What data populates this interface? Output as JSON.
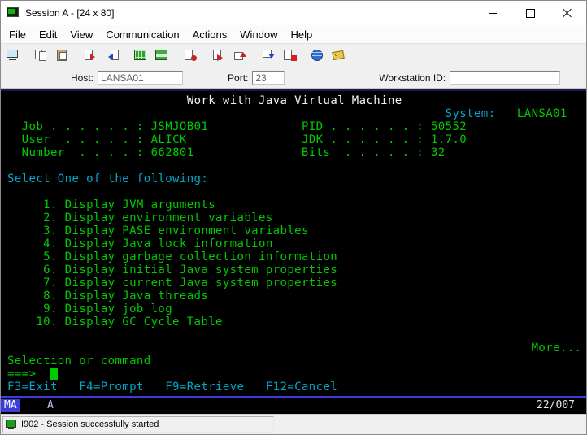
{
  "window": {
    "title": "Session A - [24 x 80]",
    "controls": [
      "minimize-icon",
      "maximize-icon",
      "close-icon"
    ]
  },
  "menu": {
    "items": [
      "File",
      "Edit",
      "View",
      "Communication",
      "Actions",
      "Window",
      "Help"
    ]
  },
  "toolbar": {
    "icons": [
      "new-session-icon",
      "copy-icon",
      "paste-icon",
      "send-file-icon",
      "receive-file-icon",
      "display-map-icon",
      "color-setup-icon",
      "record-macro-icon",
      "play-macro-icon",
      "send-screen-icon",
      "receive-screen-icon",
      "stop-macro-icon",
      "communication-setup-icon",
      "keyboard-map-icon"
    ]
  },
  "hostbar": {
    "host_label": "Host:",
    "host_value": "LANSA01",
    "port_label": "Port:",
    "port_value": "23",
    "workstation_label": "Workstation ID:",
    "workstation_value": ""
  },
  "terminal": {
    "palette": {
      "g": "#00ca00",
      "c": "#00a8cc",
      "w": "#f0f0f0"
    },
    "rows": [
      {
        "segs": [
          [
            26,
            "Work with Java Virtual Machine",
            "w"
          ]
        ]
      },
      {
        "segs": [
          [
            62,
            "System:",
            "c"
          ],
          [
            72,
            "LANSA01",
            "g"
          ]
        ]
      },
      {
        "segs": [
          [
            3,
            "Job . . . . . . :",
            "g"
          ],
          [
            21,
            "JSMJOB01",
            "g"
          ],
          [
            42,
            "PID . . . . . . :",
            "g"
          ],
          [
            60,
            "50552",
            "g"
          ]
        ]
      },
      {
        "segs": [
          [
            3,
            "User  . . . . . :",
            "g"
          ],
          [
            21,
            "ALICK",
            "g"
          ],
          [
            42,
            "JDK . . . . . . :",
            "g"
          ],
          [
            60,
            "1.7.0",
            "g"
          ]
        ]
      },
      {
        "segs": [
          [
            3,
            "Number  . . . . :",
            "g"
          ],
          [
            21,
            "662801",
            "g"
          ],
          [
            42,
            "Bits  . . . . . :",
            "g"
          ],
          [
            60,
            "32",
            "g"
          ]
        ]
      },
      {
        "segs": []
      },
      {
        "segs": [
          [
            1,
            "Select One of the following:",
            "c"
          ]
        ]
      },
      {
        "segs": []
      },
      {
        "segs": [
          [
            6,
            "1. Display JVM arguments",
            "g"
          ]
        ]
      },
      {
        "segs": [
          [
            6,
            "2. Display environment variables",
            "g"
          ]
        ]
      },
      {
        "segs": [
          [
            6,
            "3. Display PASE environment variables",
            "g"
          ]
        ]
      },
      {
        "segs": [
          [
            6,
            "4. Display Java lock information",
            "g"
          ]
        ]
      },
      {
        "segs": [
          [
            6,
            "5. Display garbage collection information",
            "g"
          ]
        ]
      },
      {
        "segs": [
          [
            6,
            "6. Display initial Java system properties",
            "g"
          ]
        ]
      },
      {
        "segs": [
          [
            6,
            "7. Display current Java system properties",
            "g"
          ]
        ]
      },
      {
        "segs": [
          [
            6,
            "8. Display Java threads",
            "g"
          ]
        ]
      },
      {
        "segs": [
          [
            6,
            "9. Display job log",
            "g"
          ]
        ]
      },
      {
        "segs": [
          [
            5,
            "10. Display GC Cycle Table",
            "g"
          ]
        ]
      },
      {
        "segs": []
      },
      {
        "segs": [
          [
            74,
            "More...",
            "g"
          ]
        ]
      },
      {
        "segs": [
          [
            1,
            "Selection or command",
            "g"
          ]
        ]
      },
      {
        "segs": [
          [
            1,
            "===>",
            "g"
          ],
          [
            7,
            " ",
            "cur"
          ]
        ]
      },
      {
        "segs": [
          [
            1,
            "F3=Exit   F4=Prompt   F9=Retrieve   F12=Cancel",
            "c"
          ]
        ]
      }
    ]
  },
  "oia": {
    "badge": "MA",
    "session_short": "A",
    "cursor_position": "22/007"
  },
  "statusbar": {
    "message": "I902 - Session successfully started"
  }
}
